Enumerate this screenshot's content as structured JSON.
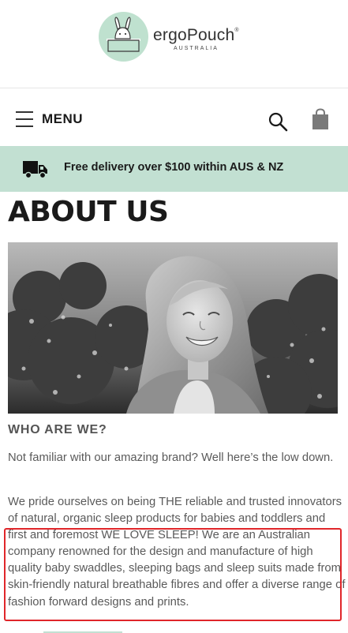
{
  "brand": {
    "name": "ergoPouch",
    "mark": "®",
    "tagline": "AUSTRALIA",
    "accent_color": "#c2e0d2"
  },
  "nav": {
    "menu_label": "MENU",
    "icons": [
      "hamburger-icon",
      "search-icon",
      "shopping-bag-icon"
    ]
  },
  "delivery": {
    "text": "Free delivery over $100 within AUS & NZ",
    "icon": "truck-icon"
  },
  "page": {
    "title": "ABOUT US",
    "section_heading": "WHO ARE WE?",
    "paragraph_1": "Not familiar with our amazing brand? Well here’s the low down.",
    "paragraph_2": "We pride ourselves on being THE reliable and trusted innovators of natural, organic sleep products for babies and toddlers and first and foremost WE LOVE SLEEP! We are an Australian company renowned for the design and manufacture of high quality baby swaddles, sleeping bags and sleep suits made from skin-friendly natural breathable fibres and offer a diverse range of fashion forward designs and prints."
  },
  "annotation": {
    "highlight_color": "#e0262a"
  }
}
